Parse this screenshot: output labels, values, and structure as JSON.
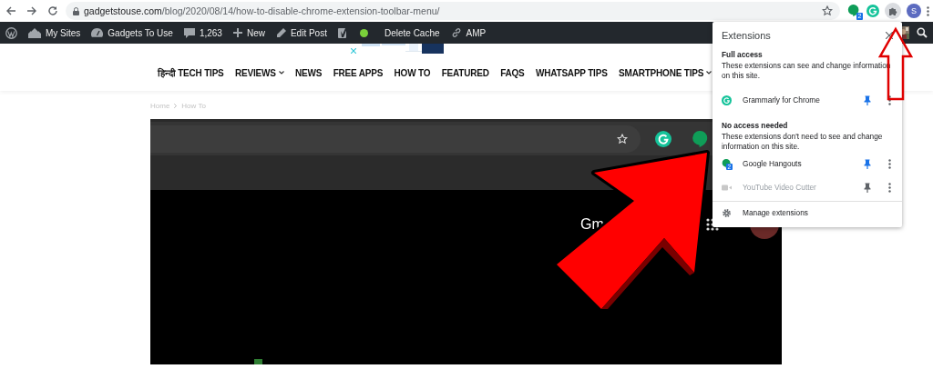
{
  "browser": {
    "url_domain": "gadgetstouse.com",
    "url_path": "/blog/2020/08/14/how-to-disable-chrome-extension-toolbar-menu/",
    "hangouts_badge": "2",
    "profile_initial": "S"
  },
  "admin_bar": [
    {
      "kind": "wordpress"
    },
    {
      "kind": "sites",
      "label": "My Sites"
    },
    {
      "kind": "dashboard",
      "label": "Gadgets To Use"
    },
    {
      "kind": "comments",
      "label": "1,263"
    },
    {
      "kind": "new",
      "label": "New"
    },
    {
      "kind": "edit",
      "label": "Edit Post"
    },
    {
      "kind": "seo"
    },
    {
      "kind": "status"
    },
    {
      "kind": "text",
      "label": "Delete Cache"
    },
    {
      "kind": "link",
      "label": "AMP"
    }
  ],
  "nav": [
    {
      "label": "हिन्दी TECH TIPS",
      "dropdown": false
    },
    {
      "label": "REVIEWS",
      "dropdown": true
    },
    {
      "label": "NEWS",
      "dropdown": false
    },
    {
      "label": "FREE APPS",
      "dropdown": false
    },
    {
      "label": "HOW TO",
      "dropdown": false
    },
    {
      "label": "FEATURED",
      "dropdown": false
    },
    {
      "label": "FAQS",
      "dropdown": false
    },
    {
      "label": "WHATSAPP TIPS",
      "dropdown": false
    },
    {
      "label": "SMARTPHONE TIPS",
      "dropdown": true
    }
  ],
  "breadcrumb": [
    "Home",
    "How To"
  ],
  "embedded": {
    "text": "Gm"
  },
  "extensions_popup": {
    "title": "Extensions",
    "sections": [
      {
        "heading": "Full access",
        "description": "These extensions can see and change information on this site.",
        "items": [
          {
            "name": "Grammarly for Chrome",
            "kind": "grammarly",
            "pinned": true,
            "disabled": false
          }
        ]
      },
      {
        "heading": "No access needed",
        "description": "These extensions don't need to see and change information on this site.",
        "items": [
          {
            "name": "Google Hangouts",
            "kind": "hangouts",
            "badge": "2",
            "pinned": true,
            "disabled": false
          },
          {
            "name": "YouTube Video Cutter",
            "kind": "video",
            "pinned": false,
            "disabled": true
          }
        ]
      }
    ],
    "footer": "Manage extensions"
  }
}
